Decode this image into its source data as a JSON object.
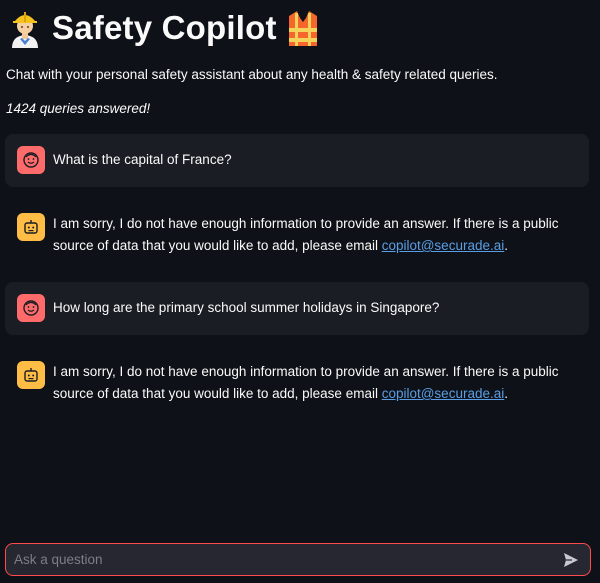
{
  "app": {
    "title": "Safety Copilot",
    "subtitle": "Chat with your personal safety assistant about any health & safety related queries.",
    "queries_answered": "1424 queries answered!"
  },
  "messages": [
    {
      "role": "user",
      "text": "What is the capital of France?"
    },
    {
      "role": "assistant",
      "text": "I am sorry, I do not have enough information to provide an answer. If there is a public source of data that you would like to add, please email ",
      "link": "copilot@securade.ai",
      "after": "."
    },
    {
      "role": "user",
      "text": "How long are the primary school summer holidays in Singapore?"
    },
    {
      "role": "assistant",
      "text": "I am sorry, I do not have enough information to provide an answer. If there is a public source of data that you would like to add, please email ",
      "link": "copilot@securade.ai",
      "after": "."
    }
  ],
  "chat_input": {
    "placeholder": "Ask a question",
    "value": ""
  },
  "icons": {
    "title_left": "construction-worker-icon",
    "title_right": "safety-vest-icon",
    "user_avatar": "user-face-icon",
    "bot_avatar": "robot-icon",
    "send": "send-icon"
  },
  "colors": {
    "background": "#0e1117",
    "user_avatar": "#ff6b6b",
    "bot_avatar": "#ffbd45",
    "link": "#5a9ee6",
    "input_border": "#ff4b4b"
  }
}
